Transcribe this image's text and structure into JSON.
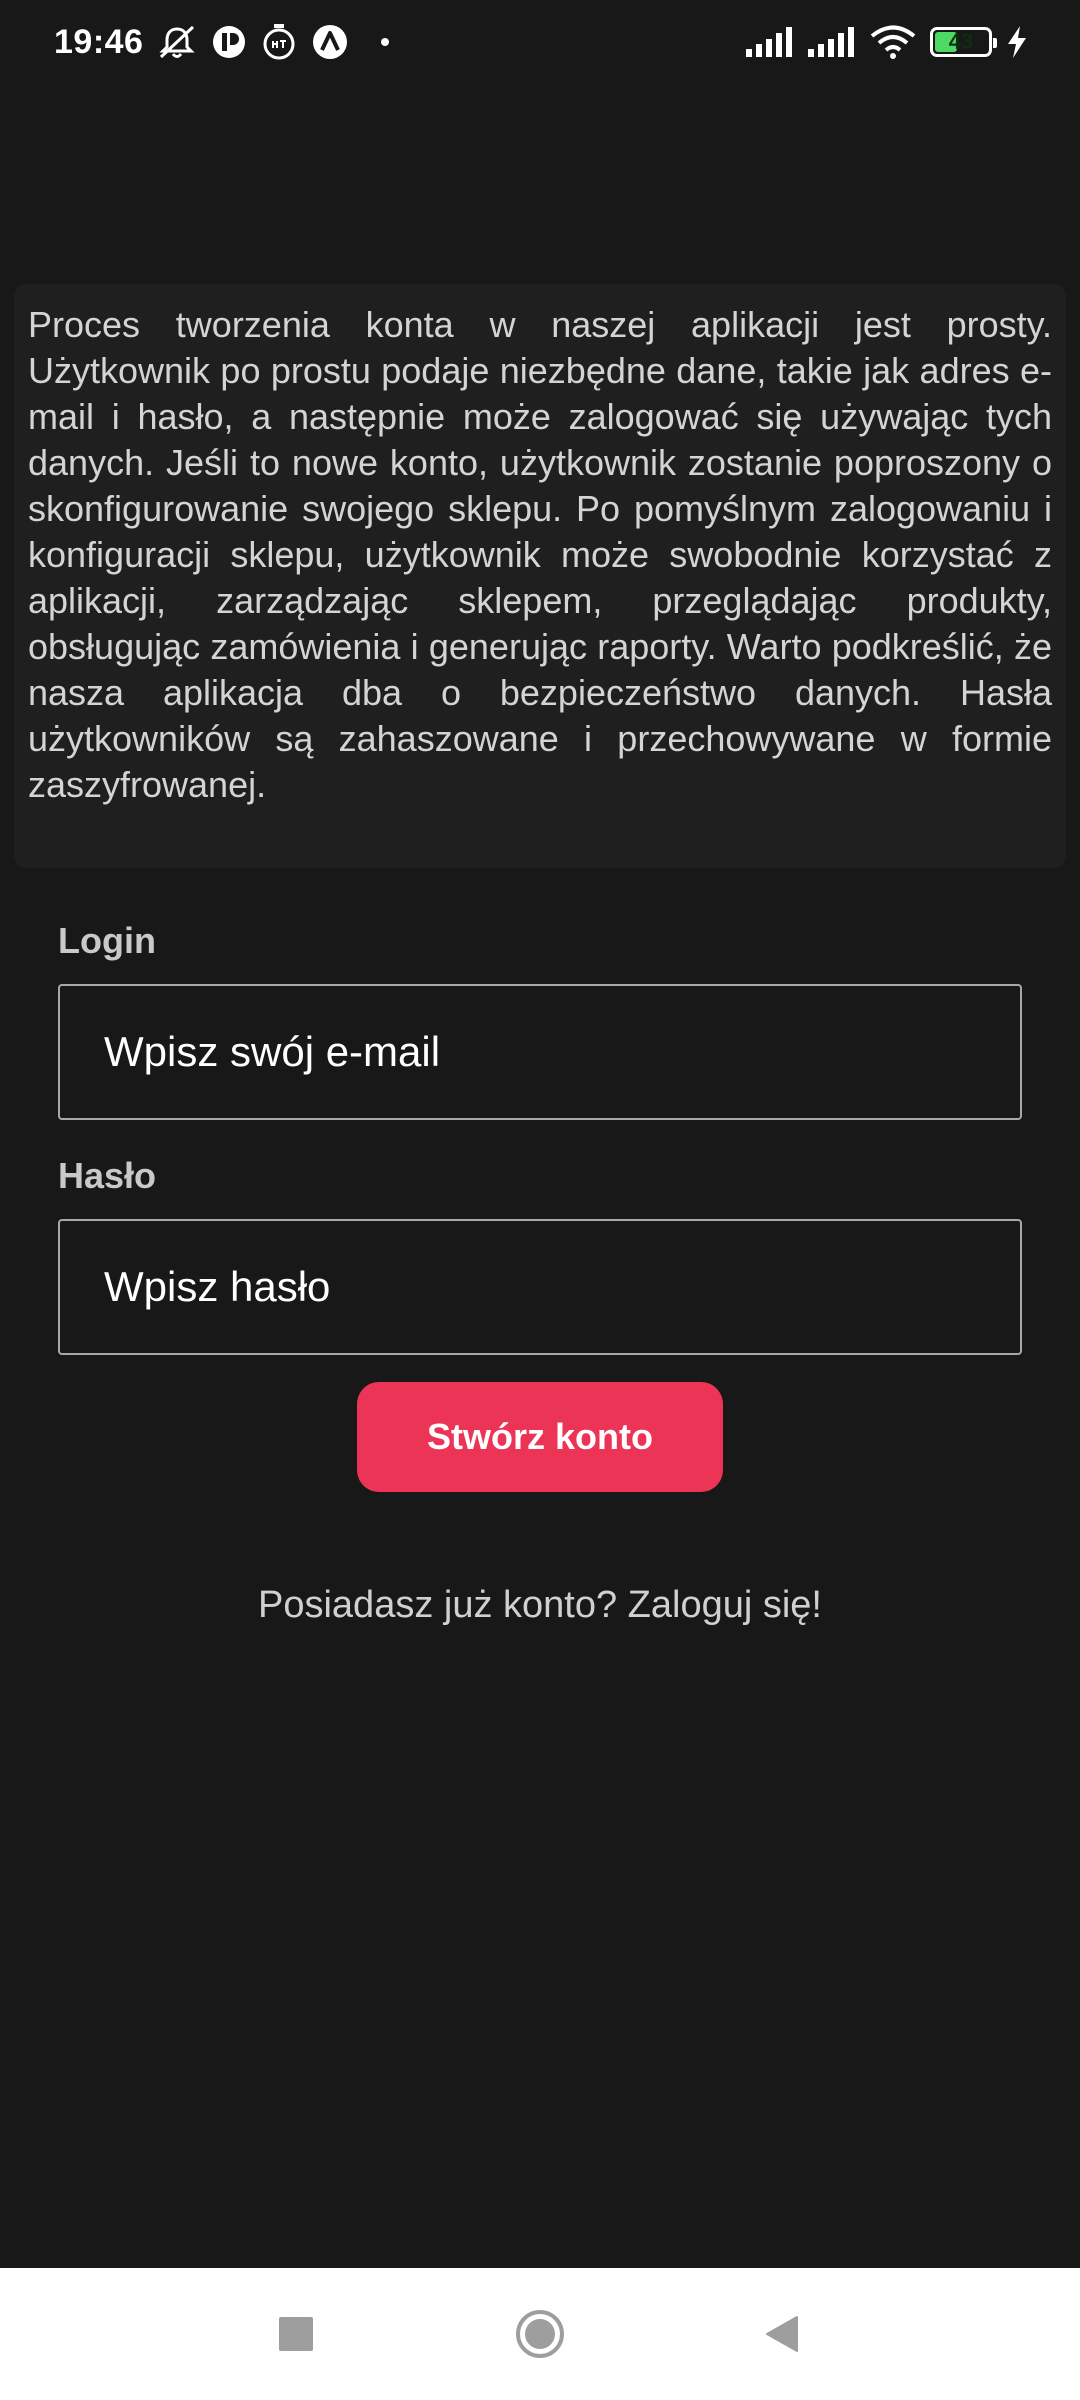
{
  "status_bar": {
    "time": "19:46",
    "battery_level": "43",
    "battery_fraction": 0.43,
    "icons": [
      "muted-alarm-icon",
      "app-notification-icon",
      "timer-icon",
      "app-launcher-icon",
      "dot-icon",
      "signal-sim1-icon",
      "signal-sim2-icon",
      "wifi-icon",
      "battery-icon",
      "charging-bolt-icon"
    ]
  },
  "info": {
    "text": "Proces tworzenia konta w naszej aplikacji jest prosty. Użytkownik po prostu podaje niezbędne dane, takie jak adres e-mail i hasło, a następnie może zalogować się używając tych danych. Jeśli to nowe konto, użytkownik zostanie poproszony o skonfigurowanie swojego sklepu. Po pomyślnym zalogowaniu i konfiguracji sklepu, użytkownik może swobodnie korzystać z aplikacji, zarządzając sklepem, przeglądając produkty, obsługując zamówienia i generując raporty. Warto podkreślić, że nasza aplikacja dba o bezpieczeństwo danych. Hasła użytkowników są zahaszowane i przechowywane w formie zaszyfrowanej."
  },
  "form": {
    "login_label": "Login",
    "login_placeholder": "Wpisz swój e-mail",
    "login_value": "",
    "password_label": "Hasło",
    "password_placeholder": "Wpisz hasło",
    "password_value": "",
    "submit_label": "Stwórz konto",
    "login_link": "Posiadasz już konto? Zaloguj się!"
  },
  "colors": {
    "background": "#181818",
    "card": "#1f1f1f",
    "accent": "#ec3457",
    "nav_bar": "#ffffff"
  },
  "nav_bar": {
    "icons": [
      "recents-square-icon",
      "home-circle-icon",
      "back-triangle-icon"
    ]
  }
}
